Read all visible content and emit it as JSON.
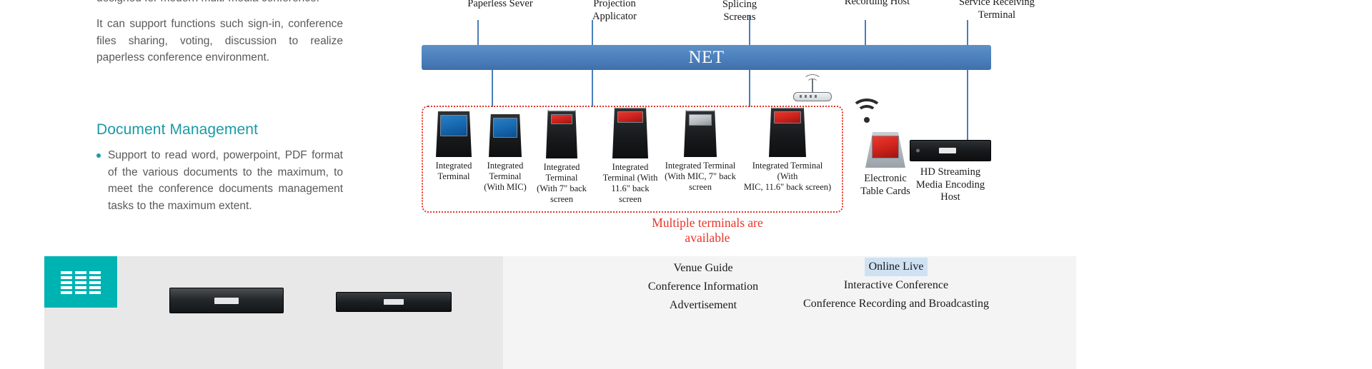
{
  "left_column": {
    "paragraphs": [
      "designed for modern multi-media conference.",
      "It can support functions such sign-in, conference files sharing, voting, discussion to realize paperless conference environment."
    ],
    "section_heading": "Document Management",
    "bullet": "Support to read word, powerpoint, PDF format of the various documents to the maximum, to meet the conference documents management tasks to the maximum extent.",
    "accent_color": "#1a9ba4",
    "body_color": "#58595b"
  },
  "diagram": {
    "net_label": "NET",
    "net_color": "#4a7ebb",
    "group_box_color": "#e8342a",
    "caption": "Multiple terminals are\navailable",
    "top_devices": [
      {
        "label": "Paperless Sever",
        "icon": "rack-server-icon"
      },
      {
        "label": "Projection\nApplicator",
        "icon": "projector-icon"
      },
      {
        "label": "Splicing\nScreens",
        "icon": "splicing-screens-icon"
      },
      {
        "label": "Recording Host",
        "icon": "recording-host-icon"
      },
      {
        "label": "Service Receiving\nTerminal",
        "icon": "service-terminal-icon"
      }
    ],
    "terminals": [
      {
        "label": "Integrated\nTerminal",
        "screen": "blue"
      },
      {
        "label": "Integrated\nTerminal\n(With MIC)",
        "screen": "blue"
      },
      {
        "label": "Integrated\nTerminal\n(With 7\" back\nscreen",
        "screen": "red"
      },
      {
        "label": "Integrated\nTerminal (With\n11.6\" back screen",
        "screen": "red"
      },
      {
        "label": "Integrated Terminal\n(With MIC, 7\" back\nscreen",
        "screen": "red"
      },
      {
        "label": "Integrated Terminal (With\nMIC, 11.6\" back screen)",
        "screen": "red"
      }
    ],
    "right_devices": [
      {
        "label": "Electronic\nTable Cards",
        "icon": "electronic-table-card-icon"
      },
      {
        "label": "HD Streaming\nMedia Encoding\nHost",
        "icon": "hd-streaming-host-icon"
      }
    ],
    "icons": {
      "router": "wifi-router-icon",
      "wifi": "wifi-signal-icon"
    }
  },
  "bottom_strip": {
    "teal_icon": "server-stack-icon",
    "teal_color": "#00b3b3",
    "column_a": [
      "Venue Guide",
      "Conference Information",
      "Advertisement"
    ],
    "column_b": [
      "Online Live",
      "Interactive Conference",
      "Conference Recording and Broadcasting"
    ],
    "highlight_color": "#cfe2f3"
  }
}
